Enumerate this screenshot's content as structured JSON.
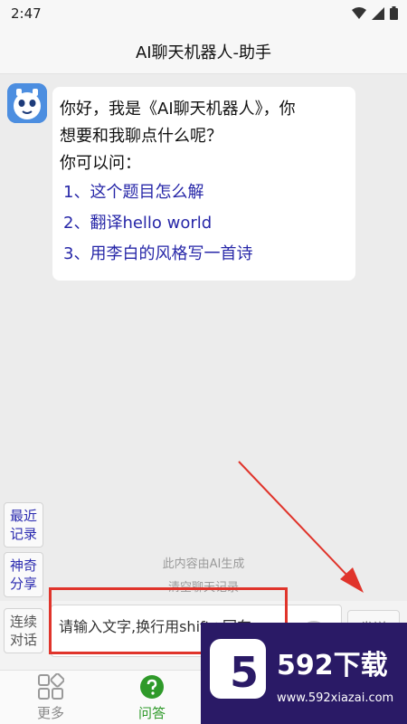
{
  "status_bar": {
    "time": "2:47"
  },
  "header": {
    "title": "AI聊天机器人-助手"
  },
  "message": {
    "lines": [
      "你好，我是《AI聊天机器人》，你",
      "想要和我聊点什么呢？",
      "你可以问："
    ],
    "questions": [
      "1、这个题目怎么解",
      "2、翻译hello world",
      "3、用李白的风格写一首诗"
    ]
  },
  "side_buttons": {
    "recent": [
      "最近",
      "记录"
    ],
    "share": [
      "神奇",
      "分享"
    ],
    "continuous": [
      "连续",
      "对话"
    ]
  },
  "notices": {
    "ai_generated": "此内容由AI生成",
    "clear_history": "清空聊天记录"
  },
  "input": {
    "placeholder": "请输入文字,换行用shift+回车",
    "send_label": "发送"
  },
  "tabs": [
    {
      "label": "更多",
      "icon": "grid-icon"
    },
    {
      "label": "问答",
      "icon": "question-icon",
      "active": true
    }
  ],
  "watermark": {
    "logo": "5",
    "brand": "592下载",
    "url": "www.592xiazai.com"
  },
  "colors": {
    "question_text": "#2727a8",
    "active_tab": "#2f9a2a",
    "annotation": "#e0342b"
  }
}
